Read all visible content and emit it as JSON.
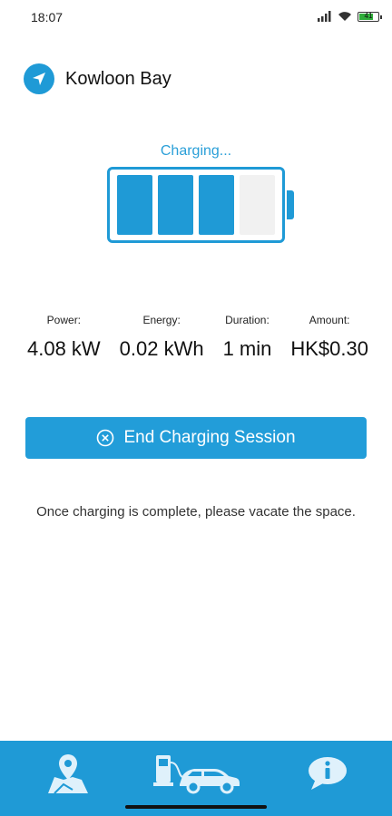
{
  "status_bar": {
    "time": "18:07",
    "battery_text": "41",
    "icons": [
      "signal-icon",
      "wifi-icon",
      "battery-icon"
    ]
  },
  "location": {
    "name": "Kowloon Bay",
    "icon": "navigation-arrow-icon"
  },
  "charging": {
    "status": "Charging...",
    "battery_level_fraction": 0.75,
    "cells_total": 4,
    "cells_filled": 3
  },
  "stats": [
    {
      "label": "Power:",
      "value": "4.08 kW"
    },
    {
      "label": "Energy:",
      "value": "0.02 kWh"
    },
    {
      "label": "Duration:",
      "value": "1 min"
    },
    {
      "label": "Amount:",
      "value": "HK$0.30"
    }
  ],
  "end_button": {
    "label": "End Charging Session",
    "icon": "close-circle-icon"
  },
  "notice": "Once charging is complete, please vacate the space.",
  "bottom_nav": {
    "items": [
      {
        "icon": "map-location-icon"
      },
      {
        "icon": "ev-charging-car-icon"
      },
      {
        "icon": "info-bubble-icon"
      }
    ]
  },
  "colors": {
    "accent": "#1f9ad6",
    "empty_cell": "#f1f1f1",
    "text": "#222222"
  }
}
